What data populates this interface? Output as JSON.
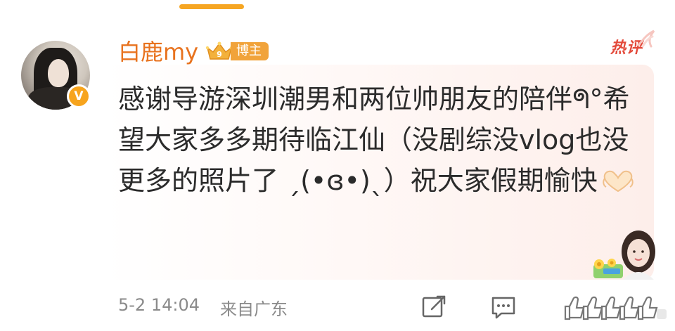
{
  "author": {
    "name": "白鹿my",
    "badge_label": "博主",
    "crown_level": "9"
  },
  "hot_label": "热评",
  "comment": {
    "text_main": "感谢导游深圳潮男和两位帅朋友的陪伴ᖗ°希望大家多多期待临江仙（没剧综没vlog也没更多的照片了 ˏ(•ɞ•)ˎ）祝大家假期愉快"
  },
  "meta": {
    "time": "5-2 14:04",
    "source": "来自广东"
  },
  "icons": {
    "verify": "verified-v-icon",
    "crown": "crown-icon",
    "share": "share-icon",
    "reply": "comment-icon",
    "like": "like-icon",
    "heart_hands": "heart-hands-emoji"
  },
  "colors": {
    "accent": "#f6a623",
    "username": "#e8731f",
    "hot": "#e3493a",
    "text": "#2b2b2b",
    "meta": "#8a8a8a"
  }
}
